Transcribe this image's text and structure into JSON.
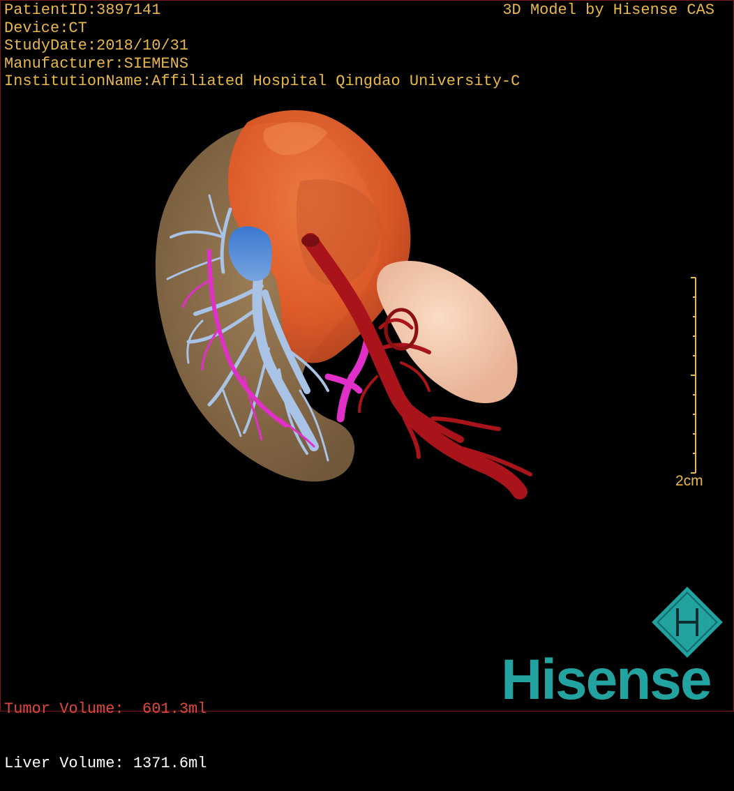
{
  "patient_info": {
    "patient_id": "PatientID:3897141",
    "device": "Device:CT",
    "study_date": "StudyDate:2018/10/31",
    "manufacturer": "Manufacturer:SIEMENS",
    "institution": "InstitutionName:Affiliated Hospital Qingdao University-C"
  },
  "model_credit": "3D Model by Hisense CAS",
  "volumes": {
    "tumor": "Tumor Volume:  601.3ml",
    "liver": "Liver Volume: 1371.6ml"
  },
  "scale_bar": {
    "label": "2cm"
  },
  "brand": {
    "logo_text": "Hisense",
    "cube_icon": "hisense-cube-icon"
  },
  "colors": {
    "text_amber": "#e8b84a",
    "tumor_red": "#e0463c",
    "liver_tan": "#9a7a52",
    "tumor_orange": "#e8622e",
    "kidney_peach": "#f4c6a8",
    "artery_red": "#a8141a",
    "portal_vein_blue": "#a9c3e6",
    "hepatic_vein_magenta": "#e030c8",
    "ivc_blue": "#4a86d8",
    "brand_teal": "#23a3a0"
  }
}
